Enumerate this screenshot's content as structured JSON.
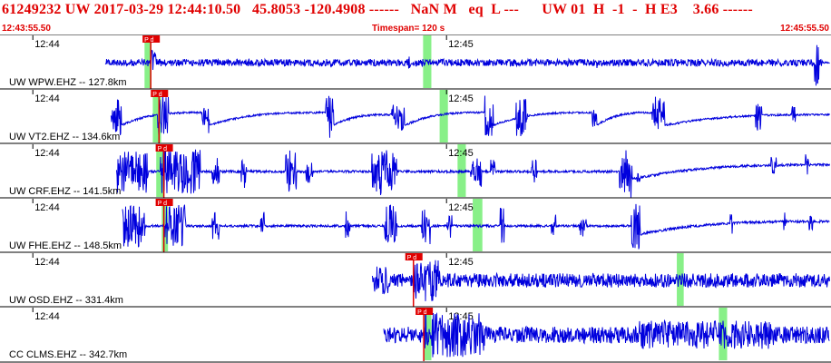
{
  "header": {
    "title": "61249232 UW 2017-03-29 12:44:10.50   45.8053 -120.4908 ------   NaN M   eq  L ---      UW 01  H  -1  -  H E3    3.66 ------",
    "start_time": "12:43:55.50",
    "timespan": "Timespan= 120 s",
    "end_time": "12:45:55.50"
  },
  "colors": {
    "trace": "#0000dd",
    "pick": "#e00000",
    "window": "#88f088",
    "text_red": "#e00000",
    "border": "#000000"
  },
  "chart_data": {
    "type": "line",
    "title": "61249232 UW 2017-03-29 12:44:10.50",
    "time_range_s": [
      0,
      120
    ],
    "tick_labels": [
      "12:44",
      "12:45"
    ],
    "tick_times_s": [
      4.5,
      64.5
    ],
    "traces": [
      {
        "label": "UW WPW.EHZ -- 127.8km",
        "pick_label": "P d",
        "pick_s": 21.6,
        "windows_s": [
          [
            20.7,
            21.7
          ],
          [
            61.1,
            62.3
          ]
        ],
        "noise": 0.03,
        "bursts": [
          [
            15,
            119,
            0.15
          ],
          [
            21.6,
            22.4,
            0.6
          ],
          [
            58.9,
            59.3,
            0.3
          ],
          [
            86.1,
            86.4,
            0.3
          ],
          [
            117.8,
            118.5,
            1.0
          ]
        ],
        "drifts": [],
        "start_s": 15.0
      },
      {
        "label": "UW VT2.EHZ -- 134.6km",
        "pick_label": "P d",
        "pick_s": 22.8,
        "windows_s": [
          [
            21.9,
            23.1
          ],
          [
            63.5,
            64.7
          ]
        ],
        "noise": 0.04,
        "bursts": [
          [
            15.8,
            17.3,
            0.8
          ],
          [
            22.6,
            24.1,
            0.9
          ],
          [
            29,
            30,
            0.4
          ],
          [
            46.9,
            48.1,
            0.9
          ],
          [
            56.5,
            58.4,
            0.6
          ],
          [
            69.9,
            71.2,
            0.8
          ],
          [
            74.6,
            76.2,
            0.9
          ],
          [
            85.6,
            86.3,
            0.6
          ],
          [
            94.3,
            96.1,
            1.0
          ],
          [
            109.3,
            110.2,
            0.7
          ],
          [
            114.5,
            115.1,
            0.4
          ]
        ],
        "drifts": [
          [
            17.3,
            29,
            0.6
          ],
          [
            30,
            47,
            0.6
          ],
          [
            48.1,
            56.5,
            0.5
          ],
          [
            58.4,
            70,
            0.6
          ],
          [
            71.2,
            85.6,
            0.6
          ],
          [
            86.3,
            94.3,
            0.6
          ],
          [
            96.1,
            120,
            0.5
          ]
        ],
        "start_s": 15.8
      },
      {
        "label": "UW CRF.EHZ -- 141.5km",
        "pick_label": "P d",
        "pick_s": 23.5,
        "windows_s": [
          [
            22.4,
            23.5
          ],
          [
            66.1,
            67.3
          ]
        ],
        "noise": 0.05,
        "bursts": [
          [
            16.6,
            21.3,
            0.9
          ],
          [
            23.0,
            28.8,
            1.0
          ],
          [
            30.5,
            31.5,
            0.6
          ],
          [
            34.7,
            35.5,
            0.7
          ],
          [
            41.1,
            42.7,
            0.9
          ],
          [
            44,
            45,
            0.5
          ],
          [
            53.6,
            57.3,
            1.0
          ],
          [
            67.9,
            69.6,
            0.7
          ],
          [
            70.8,
            71.5,
            0.5
          ],
          [
            76.8,
            77.5,
            0.5
          ],
          [
            89.6,
            91.4,
            0.9
          ],
          [
            92,
            92.6,
            0.4
          ],
          [
            111.5,
            112.3,
            0.4
          ],
          [
            116.5,
            117,
            0.5
          ]
        ],
        "drifts": [
          [
            91,
            120,
            0.7
          ]
        ],
        "start_s": 16.6
      },
      {
        "label": "UW FHE.EHZ -- 148.5km",
        "pick_label": "P d",
        "pick_s": 23.5,
        "windows_s": [
          [
            23.2,
            24.1
          ],
          [
            68.3,
            69.7
          ]
        ],
        "noise": 0.05,
        "bursts": [
          [
            17.5,
            20.7,
            0.9
          ],
          [
            23.6,
            26.6,
            0.9
          ],
          [
            30.5,
            31.5,
            0.6
          ],
          [
            37.4,
            38.1,
            0.6
          ],
          [
            49.8,
            50.5,
            0.7
          ],
          [
            55.5,
            57.3,
            0.9
          ],
          [
            60.8,
            62.2,
            0.8
          ],
          [
            64.6,
            65.3,
            0.5
          ],
          [
            72.2,
            72.8,
            0.9
          ],
          [
            79.7,
            80.3,
            0.5
          ],
          [
            83.8,
            84.8,
            0.5
          ],
          [
            91.2,
            92.6,
            1.0
          ],
          [
            105.6,
            106,
            0.5
          ],
          [
            113.3,
            113.8,
            0.6
          ],
          [
            117,
            117.5,
            0.4
          ]
        ],
        "drifts": [
          [
            92.6,
            120,
            0.6
          ]
        ],
        "start_s": 17.5
      },
      {
        "label": "UW OSD.EHZ -- 331.4km",
        "pick_label": "P d",
        "pick_s": 59.7,
        "windows_s": [
          [
            97.9,
            98.9
          ]
        ],
        "noise": 0.3,
        "bursts": [
          [
            52,
            56,
            0.6
          ],
          [
            59.7,
            63.5,
            0.9
          ]
        ],
        "drifts": [],
        "start_s": 53.8
      },
      {
        "label": "CC CLMS.EHZ -- 342.7km",
        "pick_label": "P d",
        "pick_s": 61.2,
        "windows_s": [
          [
            61.3,
            62.3
          ],
          [
            104,
            105.2
          ]
        ],
        "noise": 0.35,
        "bursts": [
          [
            61.2,
            70,
            0.95
          ],
          [
            92,
            112,
            0.6
          ]
        ],
        "drifts": [],
        "start_s": 55.5
      }
    ]
  }
}
